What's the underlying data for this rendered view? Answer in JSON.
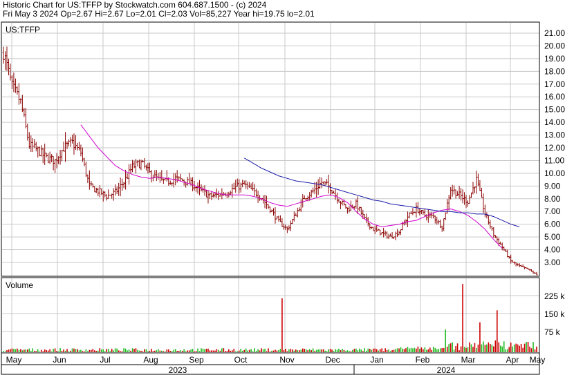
{
  "header": {
    "line1": "Historic Chart for US:TFFP by Stockwatch.com 604.687.1500 - (c) 2024",
    "line2": "Fri May  3 2024   Op=2.67  Hi=2.67  Lo=2.01  Cl=2.03  Vol=85,227  Year hi=19.75  lo=2.01"
  },
  "colors": {
    "bar": "#8b0000",
    "ma_short": "#d000d0",
    "ma_long": "#1a1aa8",
    "vol_up": "#22bb22",
    "vol_down": "#cc0000",
    "grid": "#c8c8c8"
  },
  "chart_data": [
    {
      "type": "ohlc",
      "title": "US:TFFP",
      "ylim": [
        2.0,
        21.5
      ],
      "y_ticks": [
        "21.00",
        "20.00",
        "19.00",
        "18.00",
        "17.00",
        "16.00",
        "15.00",
        "14.00",
        "13.00",
        "12.00",
        "11.00",
        "10.00",
        "9.00",
        "8.00",
        "7.00",
        "6.00",
        "5.00",
        "4.00",
        "3.00"
      ],
      "x_months": [
        "May",
        "Jun",
        "Jul",
        "Aug",
        "Sep",
        "Oct",
        "Nov",
        "Dec",
        "Jan",
        "Feb",
        "Mar",
        "Apr",
        "May"
      ],
      "x_years": [
        "2023",
        "2024"
      ],
      "close_weekly": [
        19.5,
        16.8,
        15.6,
        12.2,
        11.8,
        11.2,
        11.0,
        12.0,
        12.4,
        11.6,
        9.0,
        8.6,
        8.2,
        8.5,
        9.3,
        10.5,
        10.8,
        10.0,
        9.5,
        9.3,
        9.6,
        9.4,
        9.1,
        8.6,
        8.2,
        8.3,
        8.5,
        8.9,
        9.1,
        8.6,
        8.1,
        7.2,
        6.2,
        5.6,
        6.8,
        8.1,
        8.6,
        9.3,
        8.9,
        7.9,
        7.2,
        7.6,
        6.4,
        5.6,
        5.3,
        5.0,
        5.4,
        6.6,
        7.2,
        6.7,
        6.6,
        5.8,
        8.8,
        8.3,
        7.8,
        9.5,
        6.8,
        5.2,
        4.2,
        3.1,
        2.7,
        2.45,
        2.03
      ],
      "ma_short": {
        "start": 9,
        "values": [
          13.8,
          12.9,
          12.0,
          11.3,
          10.6,
          10.2,
          9.9,
          9.7,
          9.6,
          9.7,
          9.6,
          9.5,
          9.3,
          9.1,
          8.8,
          8.6,
          8.4,
          8.3,
          8.3,
          8.3,
          8.2,
          8.0,
          7.7,
          7.5,
          7.4,
          7.6,
          7.8,
          8.0,
          8.2,
          8.3,
          8.1,
          7.7,
          7.0,
          6.4,
          6.0,
          5.8,
          5.9,
          6.0,
          6.2,
          6.3,
          6.6,
          6.9,
          7.1,
          7.2,
          7.0,
          6.7,
          6.2,
          5.6,
          4.8,
          4.1
        ]
      },
      "ma_long": {
        "start": 28,
        "values": [
          11.2,
          10.8,
          10.4,
          10.1,
          9.8,
          9.6,
          9.4,
          9.3,
          9.2,
          9.1,
          8.9,
          8.7,
          8.5,
          8.3,
          8.1,
          7.9,
          7.8,
          7.6,
          7.5,
          7.4,
          7.3,
          7.2,
          7.1,
          7.0,
          7.0,
          6.9,
          6.9,
          6.8,
          6.8,
          6.6,
          6.3,
          6.0,
          5.8
        ]
      }
    },
    {
      "type": "bar",
      "title": "Volume",
      "y_ticks": [
        "225 k",
        "150 k",
        "75 k"
      ],
      "ylim": [
        0,
        300
      ],
      "spikes": [
        {
          "week": 32,
          "value": 225,
          "up": false
        },
        {
          "week": 51,
          "value": 95,
          "up": true
        },
        {
          "week": 53,
          "value": 285,
          "up": false
        },
        {
          "week": 55,
          "value": 125,
          "up": false
        },
        {
          "week": 57,
          "value": 175,
          "up": false
        },
        {
          "week": 62,
          "value": 90,
          "up": false
        }
      ]
    }
  ]
}
